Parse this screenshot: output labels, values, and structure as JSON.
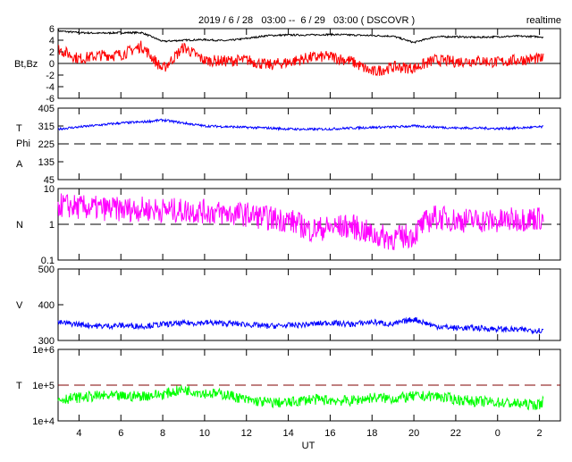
{
  "header": {
    "title": "2019 / 6 / 28   03:00 --  6 / 29   03:00 ( DSCOVR )",
    "mode": "realtime"
  },
  "chart_data": [
    {
      "type": "line",
      "ylabel": "Bt,Bz",
      "ylim": [
        -6,
        6
      ],
      "yticks": [
        "6",
        "4",
        "2",
        "0",
        "-2",
        "-4",
        "-6"
      ],
      "reference_line": 0,
      "x_hours": [
        3,
        4,
        5,
        6,
        7,
        8,
        9,
        10,
        11,
        12,
        13,
        14,
        15,
        16,
        17,
        18,
        19,
        20,
        21,
        22,
        23,
        24,
        25,
        26,
        26.2
      ],
      "series": [
        {
          "name": "Bt",
          "color": "#000000",
          "values": [
            5.6,
            5.3,
            5.2,
            5.3,
            5.3,
            3.8,
            4.0,
            4.1,
            3.9,
            4.3,
            4.8,
            4.9,
            4.9,
            5.0,
            4.9,
            4.8,
            4.7,
            3.6,
            4.6,
            4.6,
            4.5,
            4.6,
            4.7,
            4.6,
            4.2
          ]
        },
        {
          "name": "Bz",
          "color": "#ff0000",
          "values": [
            2.5,
            0.8,
            1.4,
            1.5,
            3.0,
            -1.0,
            2.8,
            0.5,
            0.4,
            0.6,
            -0.3,
            0.2,
            1.0,
            1.2,
            0.4,
            -1.5,
            -0.6,
            -0.8,
            0.6,
            0.3,
            0.5,
            0.2,
            0.6,
            0.8,
            0.4
          ]
        }
      ]
    },
    {
      "type": "line",
      "ylabel": [
        "T",
        "Phi",
        "A"
      ],
      "ylim": [
        45,
        405
      ],
      "yticks": [
        "405",
        "315",
        "225",
        "135",
        "45"
      ],
      "reference_line": 225,
      "series": [
        {
          "name": "Phi",
          "color": "#0000ff",
          "values": [
            300,
            310,
            320,
            330,
            335,
            345,
            330,
            315,
            312,
            308,
            305,
            300,
            298,
            300,
            305,
            308,
            310,
            315,
            310,
            305,
            305,
            302,
            305,
            310,
            312
          ]
        }
      ]
    },
    {
      "type": "line",
      "ylabel": "N",
      "scale": "log",
      "ylim": [
        0.1,
        10
      ],
      "yticks": [
        "10",
        "1",
        "0.1"
      ],
      "reference_line": 1,
      "series": [
        {
          "name": "N",
          "color": "#ff00ff",
          "values": [
            3.5,
            3.0,
            2.8,
            2.6,
            2.7,
            2.5,
            2.4,
            2.3,
            2.0,
            1.9,
            1.5,
            1.3,
            0.7,
            0.8,
            0.9,
            0.5,
            0.4,
            0.5,
            1.6,
            1.3,
            1.3,
            1.2,
            1.4,
            1.5,
            1.2
          ]
        }
      ]
    },
    {
      "type": "line",
      "ylabel": "V",
      "ylim": [
        300,
        500
      ],
      "yticks": [
        "500",
        "400",
        "300"
      ],
      "series": [
        {
          "name": "V",
          "color": "#0000ff",
          "values": [
            350,
            345,
            340,
            342,
            340,
            345,
            348,
            350,
            348,
            345,
            340,
            342,
            345,
            350,
            345,
            352,
            345,
            360,
            340,
            335,
            335,
            332,
            330,
            328,
            330
          ]
        }
      ]
    },
    {
      "type": "line",
      "ylabel": "T",
      "scale": "log",
      "ylim": [
        10000,
        1000000
      ],
      "yticks": [
        "1e+6",
        "1e+5",
        "1e+4"
      ],
      "reference_line": 100000,
      "series": [
        {
          "name": "T",
          "color": "#00ff00",
          "values": [
            40000,
            45000,
            50000,
            48000,
            50000,
            55000,
            75000,
            60000,
            55000,
            38000,
            33000,
            32000,
            40000,
            38000,
            36000,
            45000,
            42000,
            48000,
            50000,
            40000,
            35000,
            33000,
            30000,
            28000,
            70000
          ]
        }
      ]
    }
  ],
  "xaxis": {
    "label": "UT",
    "ticks": [
      "4",
      "6",
      "8",
      "10",
      "12",
      "14",
      "16",
      "18",
      "20",
      "22",
      "0",
      "2"
    ],
    "range_hours": [
      3,
      27
    ]
  }
}
